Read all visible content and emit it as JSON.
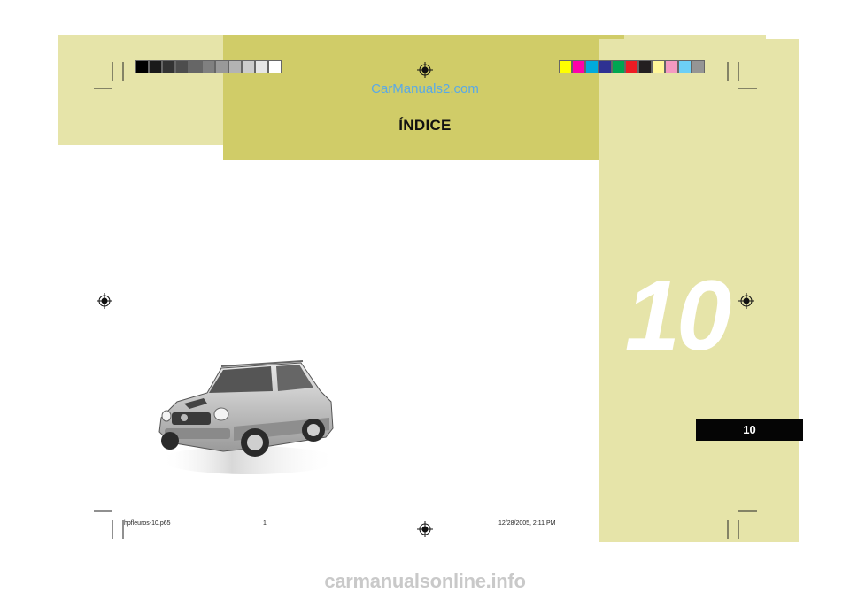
{
  "watermark_top": "CarManuals2.com",
  "title": "ÍNDICE",
  "chapter_number": "10",
  "tab_label": "10",
  "footer": {
    "file": "hpfleuros-10.p65",
    "page": "1",
    "date": "12/28/2005, 2:11 PM"
  },
  "watermark_bottom": "carmanualsonline.info",
  "colors": {
    "pale_green": "#e6e4a9",
    "olive": "#d0cc68",
    "tab_black": "#050505"
  },
  "gray_strip": [
    "#000000",
    "#1a1a1a",
    "#333333",
    "#4d4d4d",
    "#666666",
    "#808080",
    "#999999",
    "#b3b3b3",
    "#cccccc",
    "#e6e6e6",
    "#ffffff"
  ],
  "color_strip": [
    "#ffff00",
    "#ff00aa",
    "#00aadd",
    "#2e3192",
    "#00a651",
    "#ed1c24",
    "#231f20",
    "#fff799",
    "#f49ac1",
    "#6dcff6",
    "#959595"
  ]
}
